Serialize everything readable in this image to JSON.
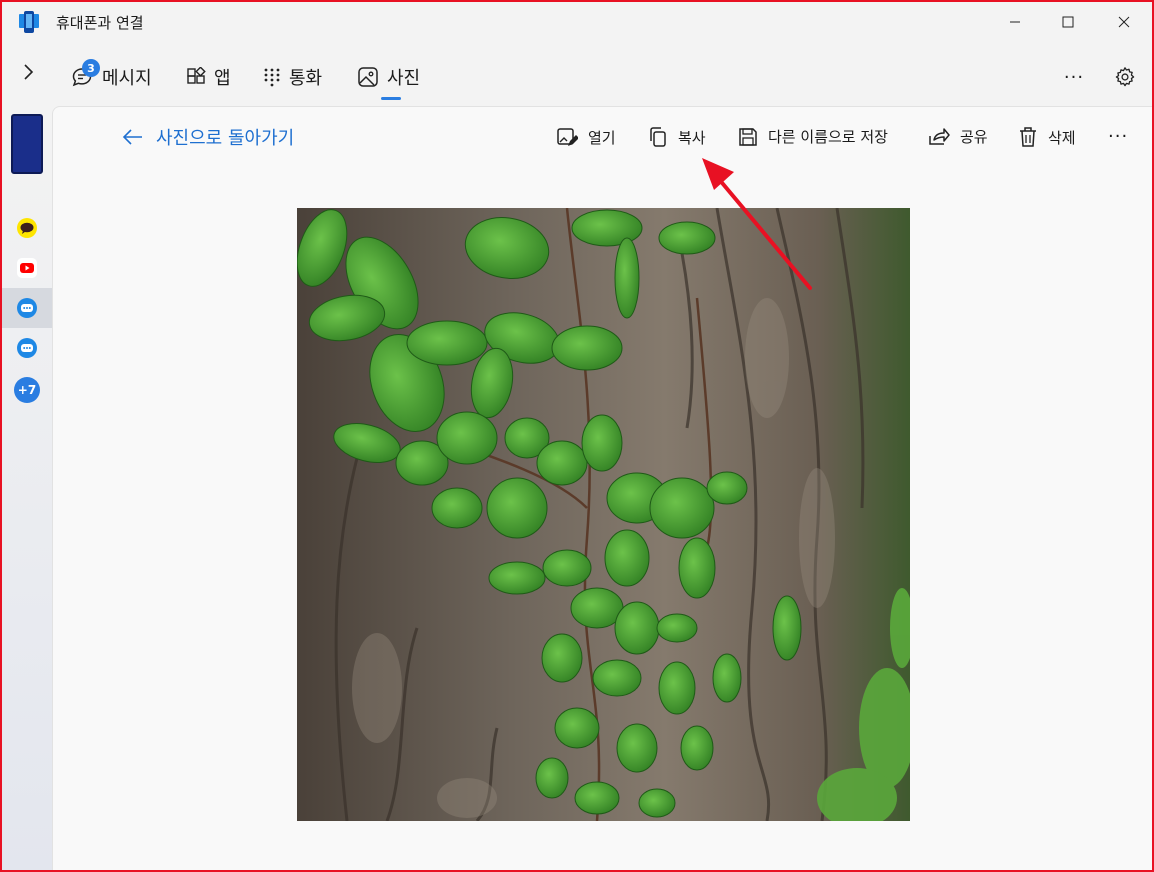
{
  "window": {
    "title": "휴대폰과 연결",
    "controls": {
      "minimize": "minimize",
      "maximize": "maximize",
      "close": "close"
    }
  },
  "nav": {
    "tabs": [
      {
        "label": "메시지",
        "icon": "chat-icon",
        "badge": "3"
      },
      {
        "label": "앱",
        "icon": "apps-icon"
      },
      {
        "label": "통화",
        "icon": "dialpad-icon"
      },
      {
        "label": "사진",
        "icon": "photo-icon",
        "selected": true
      }
    ],
    "more": "···"
  },
  "rail": {
    "apps": [
      "kakaotalk-icon",
      "youtube-icon",
      "messages-icon",
      "messages-icon"
    ],
    "more_label": "+7"
  },
  "viewer": {
    "back_label": "사진으로 돌아가기",
    "actions": {
      "open": "열기",
      "copy": "복사",
      "save_as": "다른 이름으로 저장",
      "share": "공유",
      "delete": "삭제"
    },
    "more": "···"
  },
  "colors": {
    "accent": "#2a7de1",
    "link": "#1e6fd0",
    "annotation": "#e81123"
  }
}
